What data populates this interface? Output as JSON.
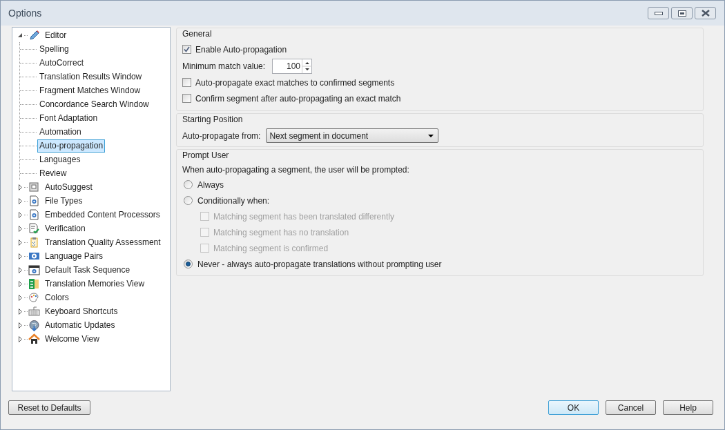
{
  "window": {
    "title": "Options"
  },
  "tree": [
    {
      "label": "Editor",
      "kind": "pencil",
      "expanded": true,
      "selected": false,
      "children": [
        {
          "label": "Spelling",
          "selected": false
        },
        {
          "label": "AutoCorrect",
          "selected": false
        },
        {
          "label": "Translation Results Window",
          "selected": false
        },
        {
          "label": "Fragment Matches Window",
          "selected": false
        },
        {
          "label": "Concordance Search Window",
          "selected": false
        },
        {
          "label": "Font Adaptation",
          "selected": false
        },
        {
          "label": "Automation",
          "selected": false
        },
        {
          "label": "Auto-propagation",
          "selected": true
        },
        {
          "label": "Languages",
          "selected": false
        },
        {
          "label": "Review",
          "selected": false
        }
      ]
    },
    {
      "label": "AutoSuggest",
      "kind": "panel",
      "expanded": false,
      "selected": false
    },
    {
      "label": "File Types",
      "kind": "gear-doc",
      "expanded": false,
      "selected": false
    },
    {
      "label": "Embedded Content Processors",
      "kind": "gear-doc",
      "expanded": false,
      "selected": false
    },
    {
      "label": "Verification",
      "kind": "check-doc",
      "expanded": false,
      "selected": false
    },
    {
      "label": "Translation Quality Assessment",
      "kind": "clipboard",
      "expanded": false,
      "selected": false
    },
    {
      "label": "Language Pairs",
      "kind": "globe-card",
      "expanded": false,
      "selected": false
    },
    {
      "label": "Default Task Sequence",
      "kind": "gear-window",
      "expanded": false,
      "selected": false
    },
    {
      "label": "Translation Memories View",
      "kind": "book",
      "expanded": false,
      "selected": false
    },
    {
      "label": "Colors",
      "kind": "palette",
      "expanded": false,
      "selected": false
    },
    {
      "label": "Keyboard Shortcuts",
      "kind": "keyboard",
      "expanded": false,
      "selected": false
    },
    {
      "label": "Automatic Updates",
      "kind": "globe",
      "expanded": false,
      "selected": false
    },
    {
      "label": "Welcome View",
      "kind": "house",
      "expanded": false,
      "selected": false
    }
  ],
  "general": {
    "title": "General",
    "enable": {
      "label": "Enable Auto-propagation",
      "checked": true
    },
    "minimum": {
      "label": "Minimum match value:",
      "value": "100"
    },
    "options": [
      {
        "label": "Auto-propagate exact matches to confirmed segments",
        "checked": false
      },
      {
        "label": "Confirm segment after auto-propagating an exact match",
        "checked": false
      }
    ]
  },
  "starting_position": {
    "title": "Starting Position",
    "label": "Auto-propagate from:",
    "value": "Next segment in document"
  },
  "prompt_user": {
    "title": "Prompt User",
    "text": "When auto-propagating a segment, the user will be prompted:",
    "options": [
      {
        "label": "Always",
        "selected": false
      },
      {
        "label": "Conditionally when:",
        "selected": false,
        "conditions": [
          {
            "label": "Matching segment has been translated differently",
            "checked": false,
            "disabled": true
          },
          {
            "label": "Matching segment has no translation",
            "checked": false,
            "disabled": true
          },
          {
            "label": "Matching segment is confirmed",
            "checked": false,
            "disabled": true
          }
        ]
      },
      {
        "label": "Never - always auto-propagate translations without prompting user",
        "selected": true
      }
    ]
  },
  "buttons": {
    "reset": "Reset to Defaults",
    "ok": "OK",
    "cancel": "Cancel",
    "help": "Help"
  }
}
